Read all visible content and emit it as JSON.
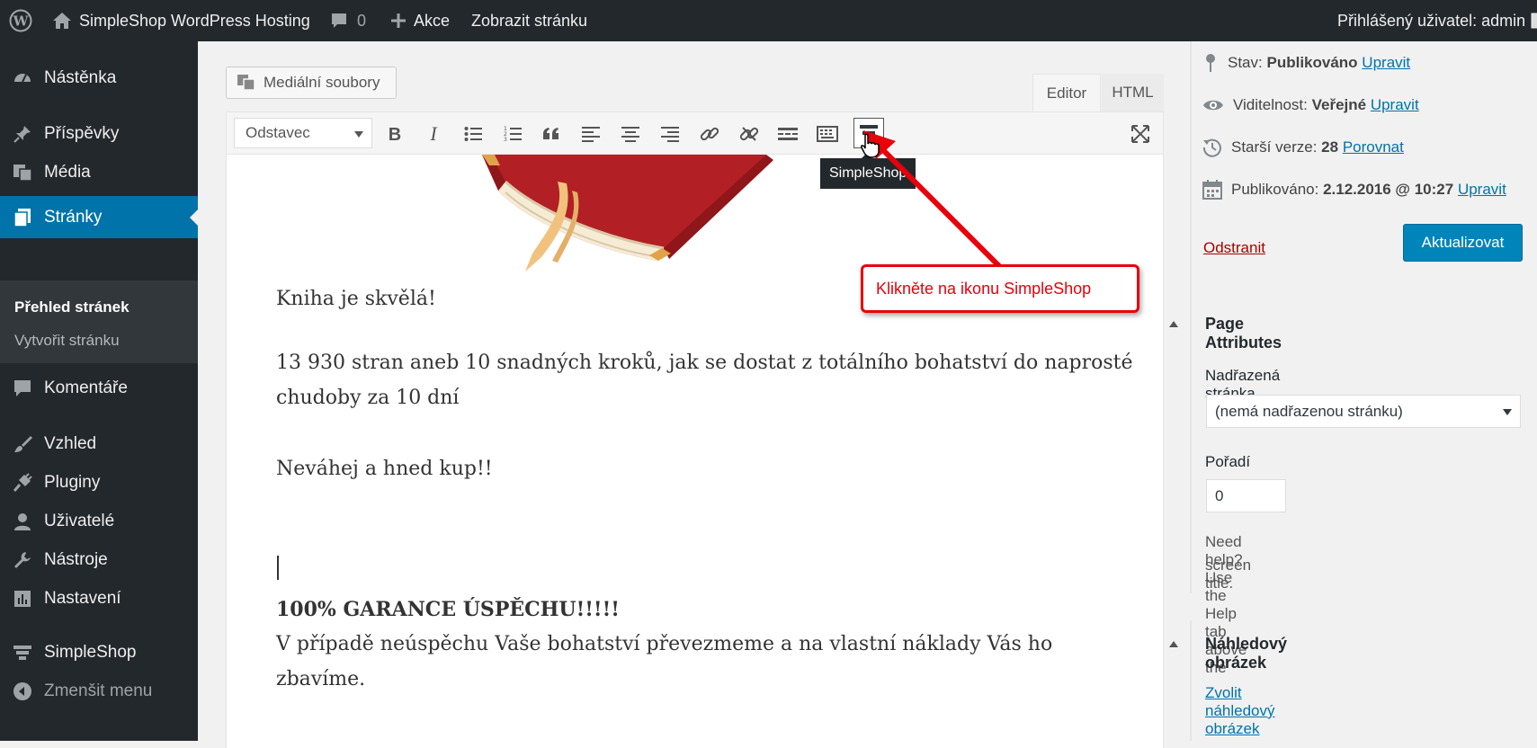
{
  "adminbar": {
    "site_name": "SimpleShop WordPress Hosting",
    "comments_count": "0",
    "new_label": "Akce",
    "view_page": "Zobrazit stránku",
    "user_greeting": "Přihlášený uživatel: admin"
  },
  "menu": {
    "dashboard": "Nástěnka",
    "posts": "Příspěvky",
    "media": "Média",
    "pages": "Stránky",
    "pages_sub": {
      "all": "Přehled stránek",
      "add": "Vytvořit stránku"
    },
    "comments": "Komentáře",
    "appearance": "Vzhled",
    "plugins": "Pluginy",
    "users": "Uživatelé",
    "tools": "Nástroje",
    "settings": "Nastavení",
    "simpleshop": "SimpleShop",
    "collapse": "Zmenšit menu"
  },
  "editor": {
    "media_button": "Mediální soubory",
    "tab_visual": "Editor",
    "tab_text": "HTML",
    "format": "Odstavec",
    "tooltip": "SimpleShop",
    "callout": "Klikněte na ikonu SimpleShop",
    "content": {
      "p1": "Kniha je skvělá!",
      "p2a": "13 930 stran aneb 10 snadných kroků, jak se dostat z totálního bohatství do naprosté",
      "p2b": "chudoby za 10 dní",
      "p3": "Neváhej a hned kup!!",
      "p4": "100% GARANCE ÚSPĚCHU!!!!!",
      "p5a": "V případě neúspěchu Vaše bohatství převezmeme a na vlastní náklady Vás ho",
      "p5b": "zbavíme."
    }
  },
  "publish": {
    "status_label": "Stav:",
    "status_value": "Publikováno",
    "status_edit": "Upravit",
    "visibility_label": "Viditelnost:",
    "visibility_value": "Veřejné",
    "visibility_edit": "Upravit",
    "revisions_label": "Starší verze:",
    "revisions_value": "28",
    "revisions_link": "Porovnat",
    "published_label": "Publikováno:",
    "published_value": "2.12.2016 @ 10:27",
    "published_edit": "Upravit",
    "delete": "Odstranit",
    "update": "Aktualizovat"
  },
  "attributes": {
    "title": "Page Attributes",
    "parent_label": "Nadřazená stránka",
    "parent_value": "(nemá nadřazenou stránku)",
    "order_label": "Pořadí",
    "order_value": "0",
    "help": "Need help? Use the Help tab above the",
    "help2": "screen title."
  },
  "thumbnail": {
    "title": "Náhledový obrázek",
    "link": "Zvolit náhledový obrázek"
  },
  "colors": {
    "admin_dark": "#23282d",
    "accent": "#0073aa",
    "callout": "#e8000b"
  }
}
